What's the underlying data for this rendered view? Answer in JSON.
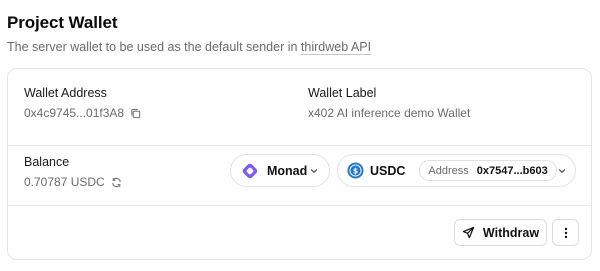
{
  "header": {
    "title": "Project Wallet",
    "subtitle_prefix": "The server wallet to be used as the default sender in ",
    "subtitle_link": "thirdweb API"
  },
  "wallet": {
    "address_label": "Wallet Address",
    "address_value": "0x4c9745...01f3A8",
    "label_label": "Wallet Label",
    "label_value": "x402 AI inference demo Wallet"
  },
  "balance": {
    "label": "Balance",
    "value": "0.70787 USDC"
  },
  "chain_select": {
    "selected": "Monad",
    "icon": "monad-icon",
    "color": "#7c5cf5"
  },
  "token_select": {
    "selected": "USDC",
    "icon": "usdc-icon",
    "color": "#2775ca",
    "address_key": "Address",
    "address_value": "0x7547...b603"
  },
  "actions": {
    "withdraw_label": "Withdraw",
    "send_icon": "send-icon",
    "more_icon": "more-vertical-icon"
  }
}
